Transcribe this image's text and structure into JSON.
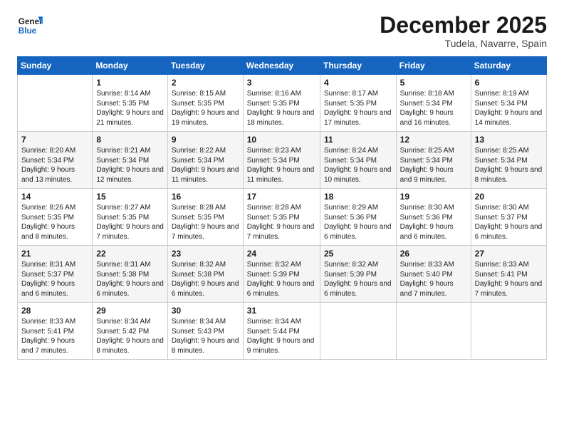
{
  "header": {
    "logo_general": "General",
    "logo_blue": "Blue",
    "month_title": "December 2025",
    "location": "Tudela, Navarre, Spain"
  },
  "weekdays": [
    "Sunday",
    "Monday",
    "Tuesday",
    "Wednesday",
    "Thursday",
    "Friday",
    "Saturday"
  ],
  "weeks": [
    [
      {
        "day": "",
        "sunrise": "",
        "sunset": "",
        "daylight": "",
        "empty": true
      },
      {
        "day": "1",
        "sunrise": "Sunrise: 8:14 AM",
        "sunset": "Sunset: 5:35 PM",
        "daylight": "Daylight: 9 hours and 21 minutes."
      },
      {
        "day": "2",
        "sunrise": "Sunrise: 8:15 AM",
        "sunset": "Sunset: 5:35 PM",
        "daylight": "Daylight: 9 hours and 19 minutes."
      },
      {
        "day": "3",
        "sunrise": "Sunrise: 8:16 AM",
        "sunset": "Sunset: 5:35 PM",
        "daylight": "Daylight: 9 hours and 18 minutes."
      },
      {
        "day": "4",
        "sunrise": "Sunrise: 8:17 AM",
        "sunset": "Sunset: 5:35 PM",
        "daylight": "Daylight: 9 hours and 17 minutes."
      },
      {
        "day": "5",
        "sunrise": "Sunrise: 8:18 AM",
        "sunset": "Sunset: 5:34 PM",
        "daylight": "Daylight: 9 hours and 16 minutes."
      },
      {
        "day": "6",
        "sunrise": "Sunrise: 8:19 AM",
        "sunset": "Sunset: 5:34 PM",
        "daylight": "Daylight: 9 hours and 14 minutes."
      }
    ],
    [
      {
        "day": "7",
        "sunrise": "Sunrise: 8:20 AM",
        "sunset": "Sunset: 5:34 PM",
        "daylight": "Daylight: 9 hours and 13 minutes."
      },
      {
        "day": "8",
        "sunrise": "Sunrise: 8:21 AM",
        "sunset": "Sunset: 5:34 PM",
        "daylight": "Daylight: 9 hours and 12 minutes."
      },
      {
        "day": "9",
        "sunrise": "Sunrise: 8:22 AM",
        "sunset": "Sunset: 5:34 PM",
        "daylight": "Daylight: 9 hours and 11 minutes."
      },
      {
        "day": "10",
        "sunrise": "Sunrise: 8:23 AM",
        "sunset": "Sunset: 5:34 PM",
        "daylight": "Daylight: 9 hours and 11 minutes."
      },
      {
        "day": "11",
        "sunrise": "Sunrise: 8:24 AM",
        "sunset": "Sunset: 5:34 PM",
        "daylight": "Daylight: 9 hours and 10 minutes."
      },
      {
        "day": "12",
        "sunrise": "Sunrise: 8:25 AM",
        "sunset": "Sunset: 5:34 PM",
        "daylight": "Daylight: 9 hours and 9 minutes."
      },
      {
        "day": "13",
        "sunrise": "Sunrise: 8:25 AM",
        "sunset": "Sunset: 5:34 PM",
        "daylight": "Daylight: 9 hours and 8 minutes."
      }
    ],
    [
      {
        "day": "14",
        "sunrise": "Sunrise: 8:26 AM",
        "sunset": "Sunset: 5:35 PM",
        "daylight": "Daylight: 9 hours and 8 minutes."
      },
      {
        "day": "15",
        "sunrise": "Sunrise: 8:27 AM",
        "sunset": "Sunset: 5:35 PM",
        "daylight": "Daylight: 9 hours and 7 minutes."
      },
      {
        "day": "16",
        "sunrise": "Sunrise: 8:28 AM",
        "sunset": "Sunset: 5:35 PM",
        "daylight": "Daylight: 9 hours and 7 minutes."
      },
      {
        "day": "17",
        "sunrise": "Sunrise: 8:28 AM",
        "sunset": "Sunset: 5:35 PM",
        "daylight": "Daylight: 9 hours and 7 minutes."
      },
      {
        "day": "18",
        "sunrise": "Sunrise: 8:29 AM",
        "sunset": "Sunset: 5:36 PM",
        "daylight": "Daylight: 9 hours and 6 minutes."
      },
      {
        "day": "19",
        "sunrise": "Sunrise: 8:30 AM",
        "sunset": "Sunset: 5:36 PM",
        "daylight": "Daylight: 9 hours and 6 minutes."
      },
      {
        "day": "20",
        "sunrise": "Sunrise: 8:30 AM",
        "sunset": "Sunset: 5:37 PM",
        "daylight": "Daylight: 9 hours and 6 minutes."
      }
    ],
    [
      {
        "day": "21",
        "sunrise": "Sunrise: 8:31 AM",
        "sunset": "Sunset: 5:37 PM",
        "daylight": "Daylight: 9 hours and 6 minutes."
      },
      {
        "day": "22",
        "sunrise": "Sunrise: 8:31 AM",
        "sunset": "Sunset: 5:38 PM",
        "daylight": "Daylight: 9 hours and 6 minutes."
      },
      {
        "day": "23",
        "sunrise": "Sunrise: 8:32 AM",
        "sunset": "Sunset: 5:38 PM",
        "daylight": "Daylight: 9 hours and 6 minutes."
      },
      {
        "day": "24",
        "sunrise": "Sunrise: 8:32 AM",
        "sunset": "Sunset: 5:39 PM",
        "daylight": "Daylight: 9 hours and 6 minutes."
      },
      {
        "day": "25",
        "sunrise": "Sunrise: 8:32 AM",
        "sunset": "Sunset: 5:39 PM",
        "daylight": "Daylight: 9 hours and 6 minutes."
      },
      {
        "day": "26",
        "sunrise": "Sunrise: 8:33 AM",
        "sunset": "Sunset: 5:40 PM",
        "daylight": "Daylight: 9 hours and 7 minutes."
      },
      {
        "day": "27",
        "sunrise": "Sunrise: 8:33 AM",
        "sunset": "Sunset: 5:41 PM",
        "daylight": "Daylight: 9 hours and 7 minutes."
      }
    ],
    [
      {
        "day": "28",
        "sunrise": "Sunrise: 8:33 AM",
        "sunset": "Sunset: 5:41 PM",
        "daylight": "Daylight: 9 hours and 7 minutes."
      },
      {
        "day": "29",
        "sunrise": "Sunrise: 8:34 AM",
        "sunset": "Sunset: 5:42 PM",
        "daylight": "Daylight: 9 hours and 8 minutes."
      },
      {
        "day": "30",
        "sunrise": "Sunrise: 8:34 AM",
        "sunset": "Sunset: 5:43 PM",
        "daylight": "Daylight: 9 hours and 8 minutes."
      },
      {
        "day": "31",
        "sunrise": "Sunrise: 8:34 AM",
        "sunset": "Sunset: 5:44 PM",
        "daylight": "Daylight: 9 hours and 9 minutes."
      },
      {
        "day": "",
        "sunrise": "",
        "sunset": "",
        "daylight": "",
        "empty": true
      },
      {
        "day": "",
        "sunrise": "",
        "sunset": "",
        "daylight": "",
        "empty": true
      },
      {
        "day": "",
        "sunrise": "",
        "sunset": "",
        "daylight": "",
        "empty": true
      }
    ]
  ]
}
